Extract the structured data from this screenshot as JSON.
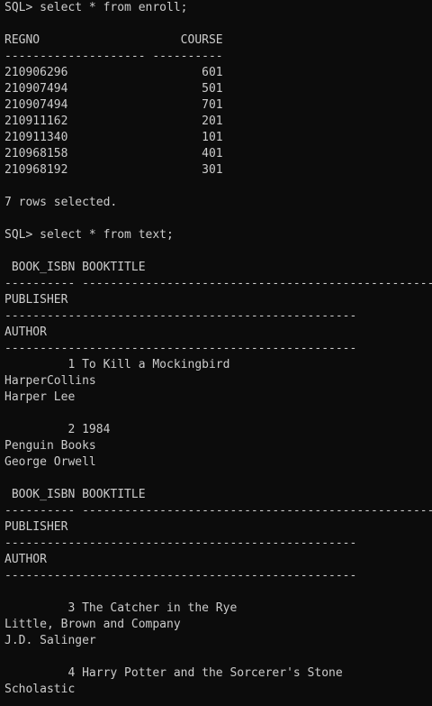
{
  "terminal": {
    "lines": [
      "SQL> select * from enroll;",
      "",
      "REGNO                    COURSE",
      "-------------------- ----------",
      "210906296                   601",
      "210907494                   501",
      "210907494                   701",
      "210911162                   201",
      "210911340                   101",
      "210968158                   401",
      "210968192                   301",
      "",
      "7 rows selected.",
      "",
      "SQL> select * from text;",
      "",
      " BOOK_ISBN BOOKTITLE",
      "---------- ----------------------------------------------------",
      "PUBLISHER",
      "--------------------------------------------------",
      "AUTHOR",
      "--------------------------------------------------",
      "         1 To Kill a Mockingbird",
      "HarperCollins",
      "Harper Lee",
      "",
      "         2 1984",
      "Penguin Books",
      "George Orwell",
      "",
      " BOOK_ISBN BOOKTITLE",
      "---------- ----------------------------------------------------",
      "PUBLISHER",
      "--------------------------------------------------",
      "AUTHOR",
      "--------------------------------------------------",
      "",
      "         3 The Catcher in the Rye",
      "Little, Brown and Company",
      "J.D. Salinger",
      "",
      "         4 Harry Potter and the Sorcerer's Stone",
      "Scholastic"
    ]
  }
}
